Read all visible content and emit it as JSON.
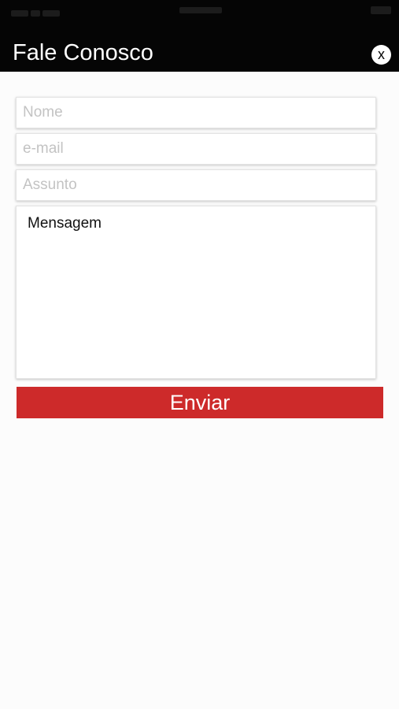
{
  "header": {
    "title": "Fale Conosco",
    "close_label": "x"
  },
  "form": {
    "name_placeholder": "Nome",
    "email_placeholder": "e-mail",
    "subject_placeholder": "Assunto",
    "message_placeholder": "Mensagem",
    "submit_label": "Enviar"
  },
  "colors": {
    "header_background": "#050505",
    "submit_background": "#cd2a2a",
    "page_background": "#fcfcfc"
  }
}
